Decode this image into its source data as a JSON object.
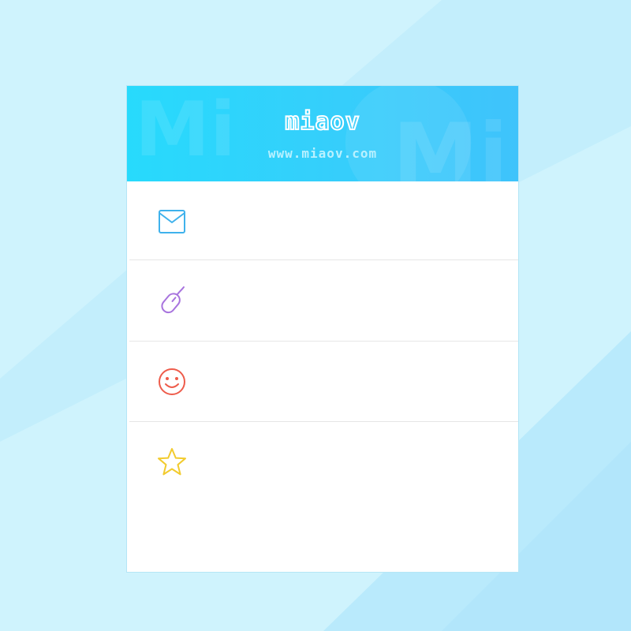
{
  "header": {
    "brand": "miaov",
    "url": "www.miaov.com"
  },
  "colors": {
    "background": "#cff3fd",
    "header_start": "#27dafc",
    "header_end": "#3fc3fb",
    "mail_icon": "#3fb2ec",
    "mouse_icon": "#a874de",
    "smile_icon": "#ee5c4b",
    "star_icon": "#f2cb2e"
  },
  "menu": {
    "items": [
      {
        "icon": "mail-icon",
        "label": ""
      },
      {
        "icon": "mouse-icon",
        "label": ""
      },
      {
        "icon": "smile-icon",
        "label": ""
      },
      {
        "icon": "star-icon",
        "label": ""
      }
    ]
  }
}
